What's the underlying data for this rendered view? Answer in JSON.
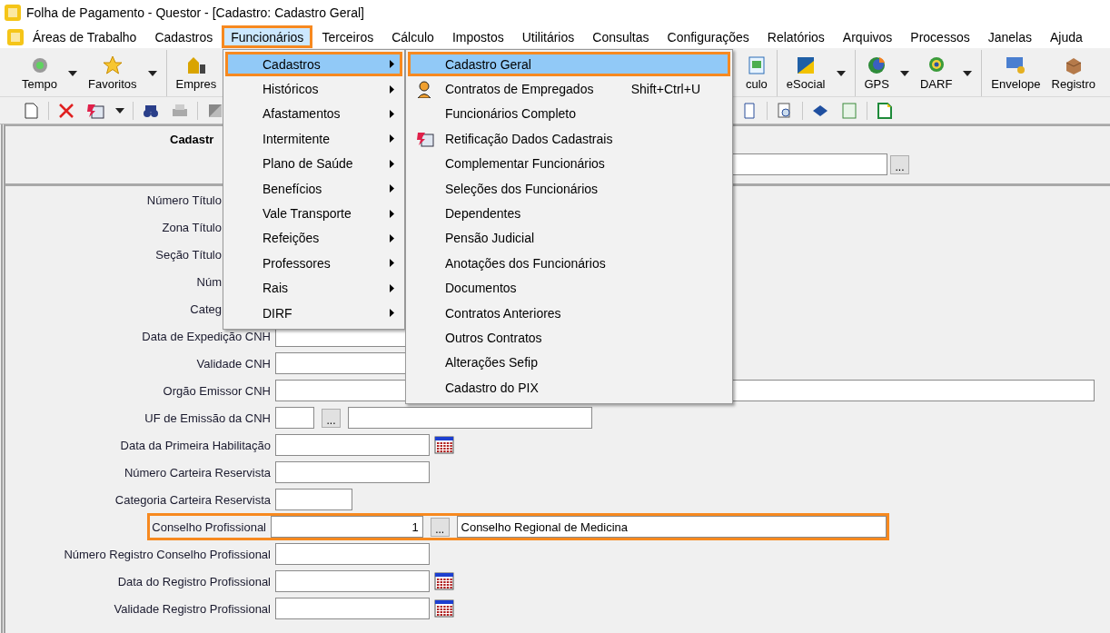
{
  "window": {
    "title": "Folha de Pagamento - Questor - [Cadastro: Cadastro Geral]"
  },
  "menu_bar": [
    {
      "label": "Áreas de Trabalho",
      "selected": false,
      "highlighted": false
    },
    {
      "label": "Cadastros",
      "selected": false,
      "highlighted": false
    },
    {
      "label": "Funcionários",
      "selected": true,
      "highlighted": true
    },
    {
      "label": "Terceiros",
      "selected": false,
      "highlighted": false
    },
    {
      "label": "Cálculo",
      "selected": false,
      "highlighted": false
    },
    {
      "label": "Impostos",
      "selected": false,
      "highlighted": false
    },
    {
      "label": "Utilitários",
      "selected": false,
      "highlighted": false
    },
    {
      "label": "Consultas",
      "selected": false,
      "highlighted": false
    },
    {
      "label": "Configurações",
      "selected": false,
      "highlighted": false
    },
    {
      "label": "Relatórios",
      "selected": false,
      "highlighted": false
    },
    {
      "label": "Arquivos",
      "selected": false,
      "highlighted": false
    },
    {
      "label": "Processos",
      "selected": false,
      "highlighted": false
    },
    {
      "label": "Janelas",
      "selected": false,
      "highlighted": false
    },
    {
      "label": "Ajuda",
      "selected": false,
      "highlighted": false
    }
  ],
  "toolbar_left": [
    [
      {
        "label": "Tempo",
        "kind": "lamp",
        "dropdown": true
      },
      {
        "label": "Favoritos",
        "kind": "star",
        "dropdown": true
      }
    ],
    [
      {
        "label": "Empres",
        "kind": "building",
        "dropdown": false
      }
    ]
  ],
  "toolbar_right": [
    [
      {
        "label": "culo",
        "kind": "calc",
        "dropdown": false
      }
    ],
    [
      {
        "label": "eSocial",
        "kind": "esocial",
        "dropdown": true
      }
    ],
    [
      {
        "label": "GPS",
        "kind": "gps",
        "dropdown": true
      },
      {
        "label": "DARF",
        "kind": "darf",
        "dropdown": true
      }
    ],
    [
      {
        "label": "Envelope",
        "kind": "envelope",
        "dropdown": false
      },
      {
        "label": "Registro",
        "kind": "register",
        "dropdown": false
      }
    ]
  ],
  "form": {
    "title": "Cadastr",
    "header_button": "...",
    "rows": [
      {
        "label": "Número Título",
        "kind": "covered",
        "highlighted": false
      },
      {
        "label": "Zona Título",
        "kind": "covered",
        "highlighted": false
      },
      {
        "label": "Seção Título",
        "kind": "covered",
        "highlighted": false
      },
      {
        "label": "Núm",
        "kind": "covered",
        "highlighted": false
      },
      {
        "label": "Categ",
        "kind": "covered",
        "highlighted": false
      },
      {
        "label": "Data de Expedição CNH",
        "kind": "text",
        "highlighted": false
      },
      {
        "label": "Validade CNH",
        "kind": "text",
        "highlighted": false
      },
      {
        "label": "Orgão Emissor CNH",
        "kind": "wide",
        "highlighted": false
      },
      {
        "label": "UF de Emissão da CNH",
        "kind": "lookup",
        "button": "...",
        "highlighted": false
      },
      {
        "label": "Data da Primeira Habilitação",
        "kind": "date",
        "highlighted": false
      },
      {
        "label": "Número Carteira Reservista",
        "kind": "text",
        "highlighted": false
      },
      {
        "label": "Categoria Carteira Reservista",
        "kind": "short",
        "highlighted": false
      },
      {
        "label": "Conselho Profissional",
        "kind": "code-lookup",
        "value": "1",
        "button": "...",
        "description": "Conselho Regional de Medicina",
        "highlighted": true
      },
      {
        "label": "Número Registro Conselho Profissional",
        "kind": "text",
        "highlighted": false
      },
      {
        "label": "Data do Registro Profissional",
        "kind": "date",
        "highlighted": false
      },
      {
        "label": "Validade Registro Profissional",
        "kind": "date",
        "highlighted": false
      }
    ]
  },
  "funcionarios_menu": [
    {
      "label": "Cadastros",
      "selected": true,
      "highlighted": true
    },
    {
      "label": "Históricos",
      "selected": false,
      "highlighted": false
    },
    {
      "label": "Afastamentos",
      "selected": false,
      "highlighted": false
    },
    {
      "label": "Intermitente",
      "selected": false,
      "highlighted": false
    },
    {
      "label": "Plano de Saúde",
      "selected": false,
      "highlighted": false
    },
    {
      "label": "Benefícios",
      "selected": false,
      "highlighted": false
    },
    {
      "label": "Vale Transporte",
      "selected": false,
      "highlighted": false
    },
    {
      "label": "Refeições",
      "selected": false,
      "highlighted": false
    },
    {
      "label": "Professores",
      "selected": false,
      "highlighted": false
    },
    {
      "label": "Rais",
      "selected": false,
      "highlighted": false
    },
    {
      "label": "DIRF",
      "selected": false,
      "highlighted": false
    }
  ],
  "cadastros_submenu": [
    {
      "label": "Cadastro Geral",
      "kind": "plain",
      "selected": true,
      "highlighted": true
    },
    {
      "label": "Contratos de Empregados",
      "kind": "avatar",
      "shortcut": "Shift+Ctrl+U",
      "selected": false,
      "highlighted": false
    },
    {
      "label": "Funcionários Completo",
      "kind": "plain",
      "selected": false,
      "highlighted": false
    },
    {
      "label": "Retificação Dados Cadastrais",
      "kind": "card",
      "selected": false,
      "highlighted": false
    },
    {
      "label": "Complementar Funcionários",
      "kind": "plain",
      "selected": false,
      "highlighted": false
    },
    {
      "label": "Seleções dos Funcionários",
      "kind": "plain",
      "selected": false,
      "highlighted": false
    },
    {
      "label": "Dependentes",
      "kind": "plain",
      "selected": false,
      "highlighted": false
    },
    {
      "label": "Pensão Judicial",
      "kind": "plain",
      "selected": false,
      "highlighted": false
    },
    {
      "label": "Anotações dos Funcionários",
      "kind": "plain",
      "selected": false,
      "highlighted": false
    },
    {
      "label": "Documentos",
      "kind": "plain",
      "selected": false,
      "highlighted": false
    },
    {
      "label": "Contratos Anteriores",
      "kind": "plain",
      "selected": false,
      "highlighted": false
    },
    {
      "label": "Outros Contratos",
      "kind": "plain",
      "selected": false,
      "highlighted": false
    },
    {
      "label": "Alterações Sefip",
      "kind": "plain",
      "selected": false,
      "highlighted": false
    },
    {
      "label": "Cadastro do PIX",
      "kind": "plain",
      "selected": false,
      "highlighted": false
    }
  ]
}
